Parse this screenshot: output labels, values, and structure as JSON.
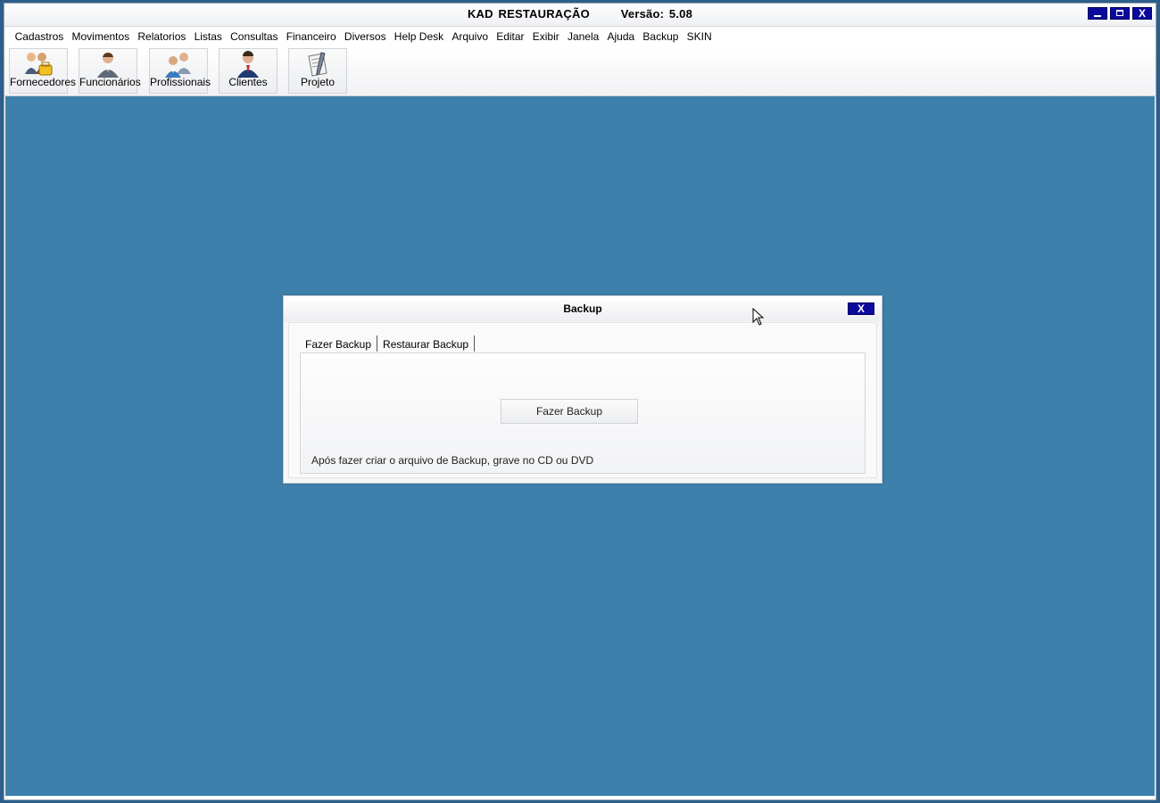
{
  "window": {
    "title": "KAD RESTAURAÇÃO      Versão: 5.08",
    "controls": {
      "minimize": "_",
      "maximize": "□",
      "close": "X"
    }
  },
  "menu": [
    "Cadastros",
    "Movimentos",
    "Relatorios",
    "Listas",
    "Consultas",
    "Financeiro",
    "Diversos",
    "Help Desk",
    "Arquivo",
    "Editar",
    "Exibir",
    "Janela",
    "Ajuda",
    "Backup",
    "SKIN"
  ],
  "toolbar": [
    {
      "label": "Fornecedores",
      "icon": "suppliers-icon"
    },
    {
      "label": "Funcionários",
      "icon": "employee-icon"
    },
    {
      "label": "Profissionais",
      "icon": "professionals-icon"
    },
    {
      "label": "Clientes",
      "icon": "client-icon"
    },
    {
      "label": "Projeto",
      "icon": "project-icon"
    }
  ],
  "dialog": {
    "title": "Backup",
    "close": "X",
    "tabs": [
      "Fazer Backup",
      "Restaurar Backup"
    ],
    "active_tab": "Fazer Backup",
    "button_label": "Fazer Backup",
    "hint": "Após fazer criar o arquivo de Backup, grave no CD ou DVD"
  },
  "colors": {
    "desktop": "#3d80ab",
    "window_button": "#0a0a9c"
  }
}
